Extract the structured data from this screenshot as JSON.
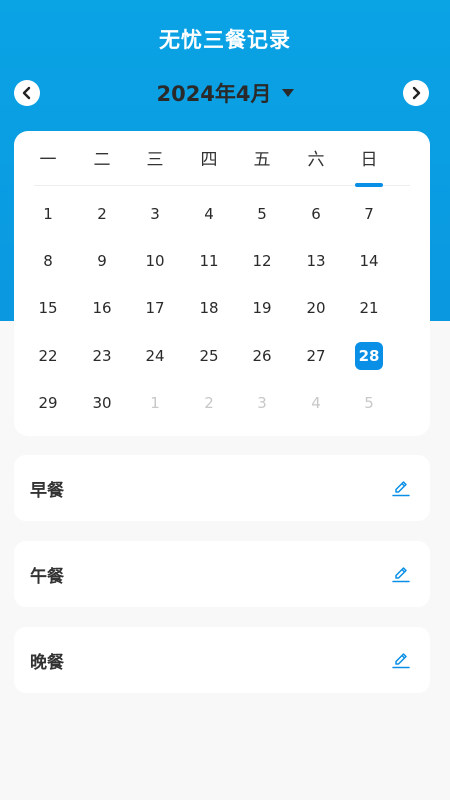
{
  "app": {
    "title": "无忧三餐记录"
  },
  "month_nav": {
    "label": "2024年4月"
  },
  "weekdays": [
    "一",
    "二",
    "三",
    "四",
    "五",
    "六",
    "日"
  ],
  "calendar": {
    "rows": [
      [
        "1",
        "2",
        "3",
        "4",
        "5",
        "6",
        "7"
      ],
      [
        "8",
        "9",
        "10",
        "11",
        "12",
        "13",
        "14"
      ],
      [
        "15",
        "16",
        "17",
        "18",
        "19",
        "20",
        "21"
      ],
      [
        "22",
        "23",
        "24",
        "25",
        "26",
        "27",
        "28"
      ],
      [
        "29",
        "30",
        "1",
        "2",
        "3",
        "4",
        "5"
      ]
    ],
    "selected_day": "28",
    "other_month_cells": [
      [
        4,
        2
      ],
      [
        4,
        3
      ],
      [
        4,
        4
      ],
      [
        4,
        5
      ],
      [
        4,
        6
      ]
    ]
  },
  "meals": [
    {
      "label": "早餐"
    },
    {
      "label": "午餐"
    },
    {
      "label": "晚餐"
    }
  ],
  "colors": {
    "header": "#0aa3e4",
    "accent": "#0a8fe6",
    "other_month_text": "#c8c8c8"
  }
}
